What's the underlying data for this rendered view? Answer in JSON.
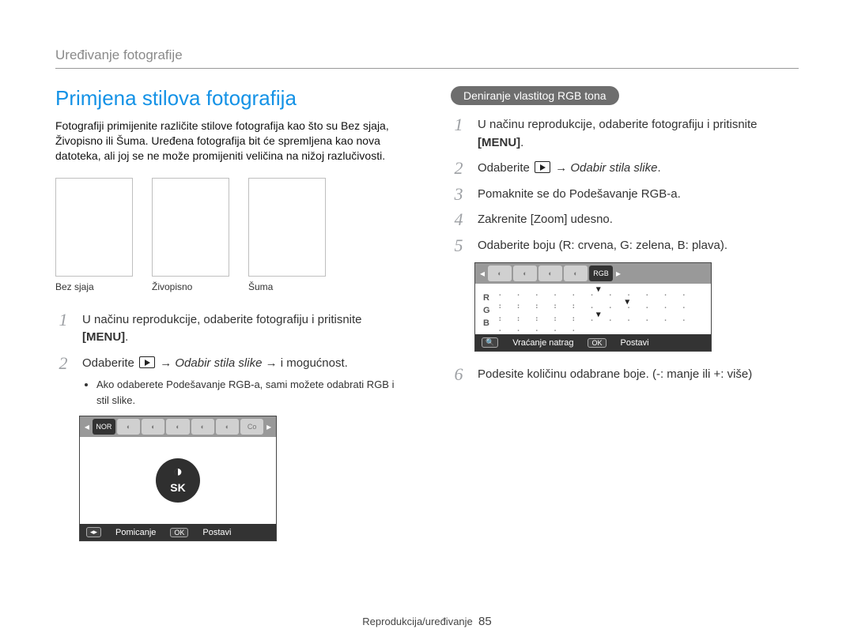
{
  "breadcrumb": "Uređivanje fotografije",
  "left": {
    "title": "Primjena stilova fotografija",
    "intro": "Fotografiji primijenite različite stilove fotografija kao što su Bez sjaja, Živopisno ili Šuma. Uređena fotografija bit će spremljena kao nova datoteka, ali joj se ne može promijeniti veličina na nižoj razlučivosti.",
    "thumb_labels": [
      "Bez sjaja",
      "Živopisno",
      "Šuma"
    ],
    "steps": {
      "s1_a": "U načinu reprodukcije, odaberite fotografiju i pritisnite ",
      "s1_menu": "[MENU]",
      "s1_b": ".",
      "s2_a": "Odaberite ",
      "s2_arrow1": " → ",
      "s2_link": "Odabir stila slike",
      "s2_arrow2": " → i mogućnost.",
      "s2_bullet": "Ako odaberete Podešavanje RGB-a, sami možete odabrati RGB i stil slike."
    },
    "ui": {
      "strip_labels": [
        "NOR",
        "",
        "",
        "",
        "",
        "",
        "Co"
      ],
      "badge": "SK",
      "footer_move": "Pomicanje",
      "footer_set": "Postavi",
      "key_ok": "OK",
      "key_arrows": "◂▸"
    }
  },
  "right": {
    "heading": "Deniranje vlastitog RGB tona",
    "steps": {
      "s1_a": "U načinu reprodukcije, odaberite fotografiju i pritisnite ",
      "s1_menu": "[MENU]",
      "s1_b": ".",
      "s2_a": "Odaberite ",
      "s2_arrow": " → ",
      "s2_link": "Odabir stila slike",
      "s2_b": ".",
      "s3": "Pomaknite se do Podešavanje RGB-a.",
      "s4": "Zakrenite [Zoom] udesno.",
      "s5": "Odaberite boju (R: crvena, G: zelena, B: plava).",
      "s6": "Podesite količinu odabrane boje. (-: manje ili +: više)"
    },
    "rgb_ui": {
      "strip": [
        "",
        "",
        "",
        "",
        "RGB"
      ],
      "rows": [
        "R",
        "G",
        "B"
      ],
      "track": ". . . . . . . . . . . . . . . .",
      "footer_back": "Vraćanje natrag",
      "footer_set": "Postavi",
      "key_zoom": "🔍",
      "key_ok": "OK"
    }
  },
  "footer": {
    "section": "Reprodukcija/uređivanje",
    "page": "85"
  }
}
